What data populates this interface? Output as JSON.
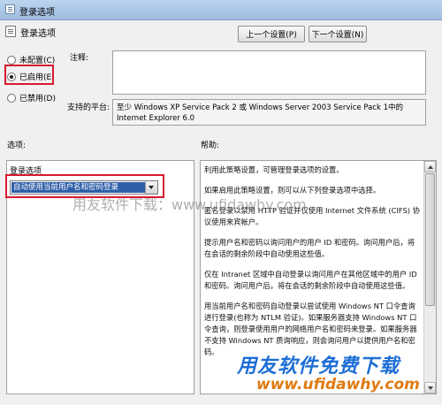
{
  "window": {
    "title": "登录选项",
    "header_title": "登录选项"
  },
  "nav": {
    "prev_label": "上一个设置(P)",
    "next_label": "下一个设置(N)"
  },
  "state": {
    "options": [
      {
        "label": "未配置(C)",
        "checked": false
      },
      {
        "label": "已启用(E)",
        "checked": true
      },
      {
        "label": "已禁用(D)",
        "checked": false
      }
    ]
  },
  "comment": {
    "label": "注释:",
    "value": ""
  },
  "supported": {
    "label": "支持的平台:",
    "value": "至少 Windows XP Service Pack 2 或 Windows Server 2003 Service Pack 1中的 Internet Explorer 6.0"
  },
  "options_panel": {
    "section_label": "选项:",
    "title": "登录选项",
    "selected_value": "自动使用当前用户名和密码登录"
  },
  "help_panel": {
    "section_label": "帮助:",
    "paragraphs": [
      "利用此策略设置，可管理登录选项的设置。",
      "如果启用此策略设置，则可以从下列登录选项中选择。",
      "匿名登录以禁用 HTTP 验证并仅使用 Internet 文件系统 (CIFS) 协议使用来宾帐户。",
      "提示用户名和密码以询问用户的用户 ID 和密码。询问用户后，将在会话的剩余阶段中自动使用这些值。",
      "仅在 Intranet 区域中自动登录以询问用户在其他区域中的用户 ID 和密码。询问用户后，将在会话的剩余阶段中自动使用这些值。",
      "用当前用户名和密码自动登录以尝试使用 Windows NT 口令查询进行登录(也称为 NTLM 验证)。如果服务器支持 Windows NT 口令查询，则登录使用用户的网络用户名和密码来登录。如果服务器不支持 Windows NT 质询响应，则会询问用户以提供用户名和密码。"
    ]
  },
  "watermarks": {
    "center": "用友软件下载：www.ufidawhy.com",
    "logo_cn": "用友软件免费下载",
    "logo_url": "www.ufidawhy.com"
  }
}
